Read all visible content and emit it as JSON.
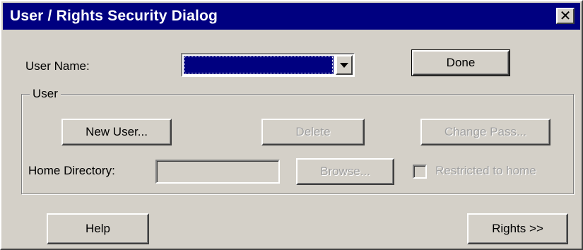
{
  "window": {
    "title": "User / Rights Security Dialog",
    "close_icon": "close-icon",
    "close_glyph": "✕"
  },
  "user_name": {
    "label": "User Name:",
    "selected_value": "",
    "dropdown_icon": "chevron-down-icon"
  },
  "buttons": {
    "done": "Done",
    "new_user": "New User...",
    "delete": "Delete",
    "change_pass": "Change Pass...",
    "browse": "Browse...",
    "help": "Help",
    "rights": "Rights >>"
  },
  "user_group": {
    "title": "User",
    "home_directory_label": "Home Directory:",
    "home_directory_value": "",
    "restricted_label": "Restricted to home",
    "restricted_checked": false
  },
  "colors": {
    "titlebar": "#000080",
    "face": "#d4d0c8",
    "selection": "#000080",
    "disabled_text": "#a0a0a0"
  }
}
